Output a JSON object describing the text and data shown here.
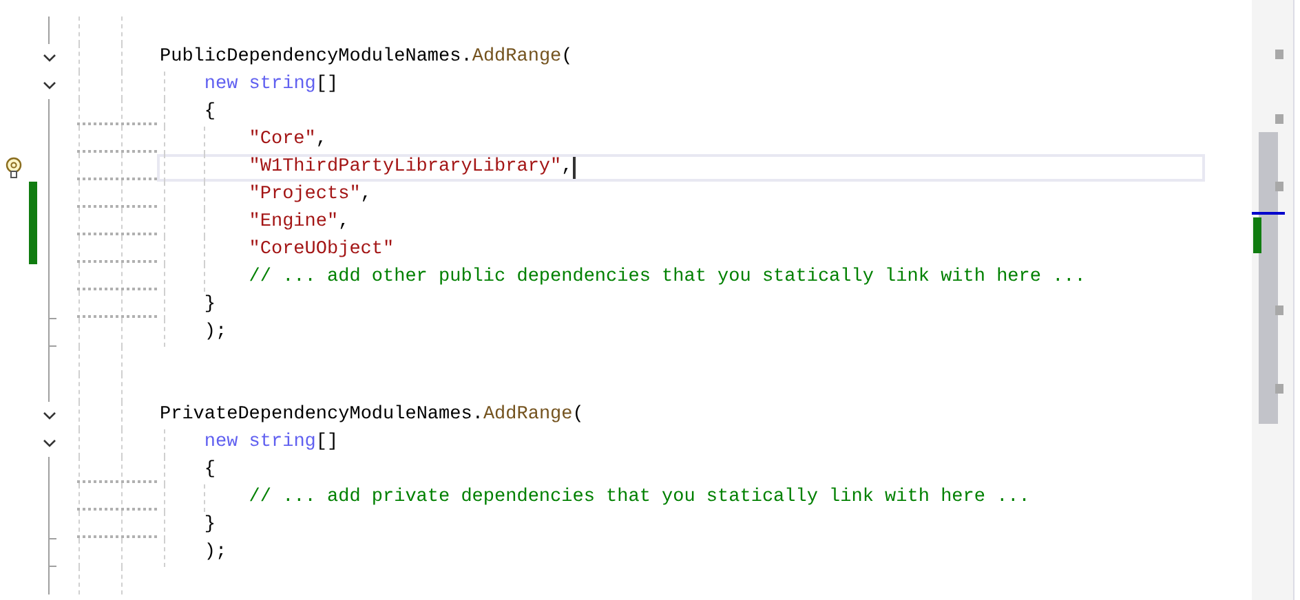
{
  "editor": {
    "lines": [
      {
        "kind": "blank"
      },
      {
        "kind": "code",
        "foldable": true,
        "tokens": [
          {
            "kind": "plain",
            "text": "PublicDependencyModuleNames."
          },
          {
            "kind": "method",
            "text": "AddRange"
          },
          {
            "kind": "plain",
            "text": "("
          }
        ],
        "children": [
          {
            "kind": "code",
            "foldable": true,
            "tokens": [
              {
                "kind": "keyword",
                "text": "new string"
              },
              {
                "kind": "plain",
                "text": "[]"
              }
            ]
          },
          {
            "kind": "code",
            "hint_dots": true,
            "tokens": [
              {
                "kind": "plain",
                "text": "{"
              }
            ],
            "children": [
              {
                "kind": "code",
                "hint_dots": true,
                "tokens": [
                  {
                    "kind": "string",
                    "text": "\"Core\""
                  },
                  {
                    "kind": "plain",
                    "text": ","
                  }
                ]
              },
              {
                "kind": "code",
                "hint_dots": true,
                "current": true,
                "lightbulb": true,
                "tokens": [
                  {
                    "kind": "string",
                    "text": "\"W1ThirdPartyLibraryLibrary\""
                  },
                  {
                    "kind": "plain",
                    "text": ","
                  }
                ]
              },
              {
                "kind": "code",
                "hint_dots": true,
                "changed": true,
                "tokens": [
                  {
                    "kind": "string",
                    "text": "\"Projects\""
                  },
                  {
                    "kind": "plain",
                    "text": ","
                  }
                ]
              },
              {
                "kind": "code",
                "hint_dots": true,
                "changed": true,
                "tokens": [
                  {
                    "kind": "string",
                    "text": "\"Engine\""
                  },
                  {
                    "kind": "plain",
                    "text": ","
                  }
                ]
              },
              {
                "kind": "code",
                "hint_dots": true,
                "changed": true,
                "tokens": [
                  {
                    "kind": "string",
                    "text": "\"CoreUObject\""
                  }
                ]
              },
              {
                "kind": "code",
                "hint_dots": true,
                "tokens": [
                  {
                    "kind": "comment",
                    "text": "// ... add other public dependencies that you statically link with here ..."
                  }
                ]
              }
            ]
          },
          {
            "kind": "code",
            "hint_dots": true,
            "fold_end": true,
            "tokens": [
              {
                "kind": "plain",
                "text": "}"
              }
            ]
          },
          {
            "kind": "code",
            "fold_end": true,
            "tokens": [
              {
                "kind": "plain",
                "text": ");"
              }
            ]
          }
        ]
      },
      {
        "kind": "blank"
      },
      {
        "kind": "blank"
      },
      {
        "kind": "code",
        "foldable": true,
        "tokens": [
          {
            "kind": "plain",
            "text": "PrivateDependencyModuleNames."
          },
          {
            "kind": "method",
            "text": "AddRange"
          },
          {
            "kind": "plain",
            "text": "("
          }
        ],
        "children": [
          {
            "kind": "code",
            "foldable": true,
            "tokens": [
              {
                "kind": "keyword",
                "text": "new string"
              },
              {
                "kind": "plain",
                "text": "[]"
              }
            ]
          },
          {
            "kind": "code",
            "hint_dots": true,
            "tokens": [
              {
                "kind": "plain",
                "text": "{"
              }
            ],
            "children": [
              {
                "kind": "code",
                "hint_dots": true,
                "tokens": [
                  {
                    "kind": "comment",
                    "text": "// ... add private dependencies that you statically link with here ..."
                  }
                ]
              }
            ]
          },
          {
            "kind": "code",
            "hint_dots": true,
            "fold_end": true,
            "tokens": [
              {
                "kind": "plain",
                "text": "}"
              }
            ]
          },
          {
            "kind": "code",
            "fold_end": true,
            "tokens": [
              {
                "kind": "plain",
                "text": ");"
              }
            ]
          }
        ]
      },
      {
        "kind": "blank"
      }
    ]
  }
}
